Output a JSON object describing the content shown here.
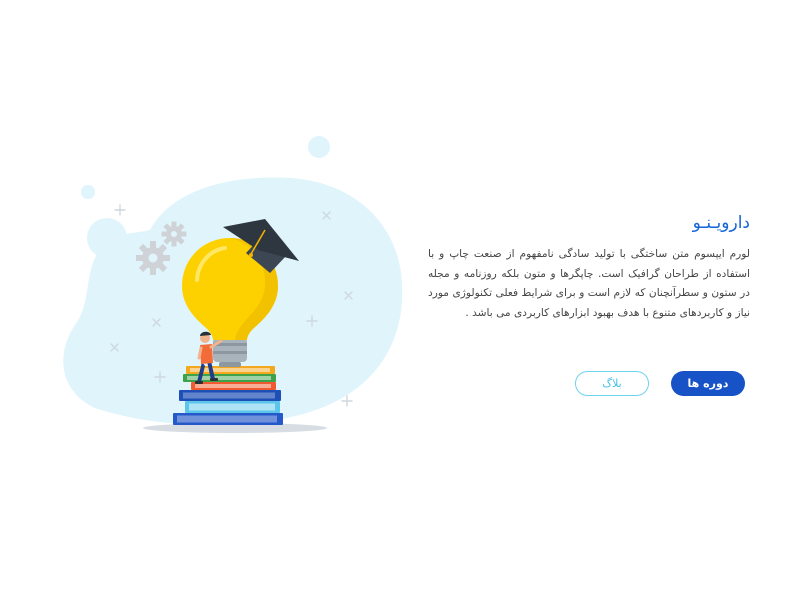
{
  "hero": {
    "title": "دارویـنـو",
    "description": "لورم ایپسوم متن ساختگی با تولید سادگی نامفهوم از صنعت چاپ و با استفاده از طراحان گرافیک است. چاپگرها و متون بلکه روزنامه و مجله در ستون و سطرآنچنان که لازم است و برای شرایط فعلی تکنولوژی مورد نیاز و کاربردهای متنوع با هدف بهبود ابزارهای کاربردی می باشد .",
    "buttons": {
      "courses_label": "دوره ها",
      "blog_label": "بلاگ"
    }
  },
  "illustration": {
    "icons": [
      "lightbulb-icon",
      "graduation-cap-icon",
      "gear-icon",
      "books-icon",
      "person-climbing-icon"
    ]
  },
  "colors": {
    "accent": "#1753c6",
    "title": "#1565d8",
    "blob": "#dff4fb",
    "bulb": "#fdd100",
    "outline_button": "#6fd2ef"
  }
}
